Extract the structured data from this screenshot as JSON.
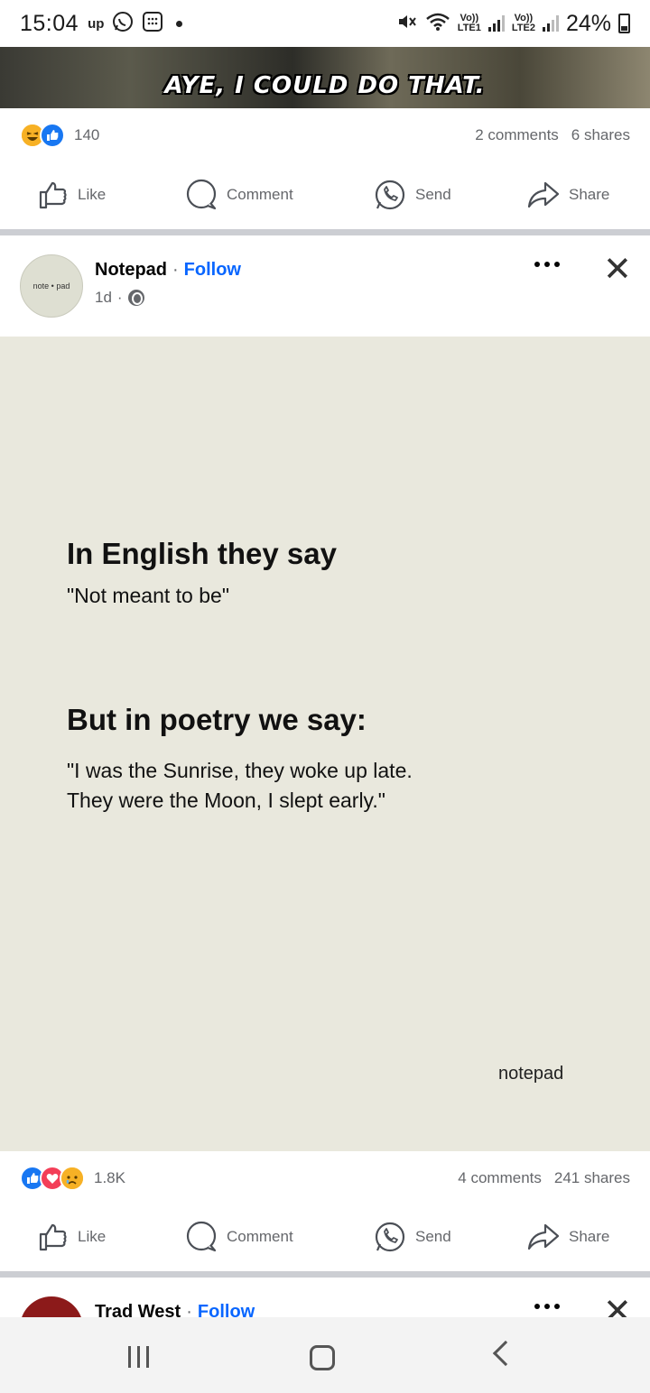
{
  "status_bar": {
    "time": "15:04",
    "up_label": "up",
    "sim1_top": "Vo))",
    "sim1_bottom": "LTE1",
    "sim2_top": "Vo))",
    "sim2_bottom": "LTE2",
    "battery": "24%"
  },
  "previous_post": {
    "image_caption": "AYE, I COULD DO THAT.",
    "reaction_count": "140",
    "comments": "2 comments",
    "shares": "6 shares"
  },
  "actions": {
    "like": "Like",
    "comment": "Comment",
    "send": "Send",
    "share": "Share"
  },
  "post": {
    "author": "Notepad",
    "separator": "·",
    "follow": "Follow",
    "time": "1d",
    "avatar_text": "note • pad",
    "image": {
      "heading1": "In English they say",
      "quote1": "\"Not meant to be\"",
      "heading2": "But in poetry we say:",
      "quote2": "\"I was the Sunrise, they woke up late. They were the Moon, I slept early.\"",
      "brand": "notepad"
    },
    "reaction_count": "1.8K",
    "comments": "4 comments",
    "shares": "241 shares"
  },
  "next_post": {
    "author": "Trad West",
    "separator": "·",
    "follow": "Follow"
  },
  "colors": {
    "facebook_blue": "#0866ff",
    "like_blue": "#1877f2",
    "love_red": "#f33e58",
    "post_background": "#e9e8dd"
  }
}
